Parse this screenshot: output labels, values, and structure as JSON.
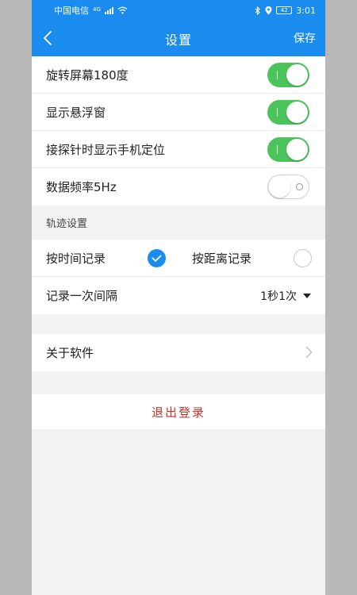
{
  "status_bar": {
    "carrier": "中国电信",
    "network": "4G",
    "battery": "42",
    "time": "3:01"
  },
  "header": {
    "title": "设置",
    "save_label": "保存"
  },
  "toggles": [
    {
      "label": "旋转屏幕180度",
      "on": true
    },
    {
      "label": "显示悬浮窗",
      "on": true
    },
    {
      "label": "接探针时显示手机定位",
      "on": true
    },
    {
      "label": "数据频率5Hz",
      "on": false
    }
  ],
  "track_settings": {
    "section_title": "轨迹设置",
    "options": [
      {
        "label": "按时间记录",
        "selected": true
      },
      {
        "label": "按距离记录",
        "selected": false
      }
    ],
    "interval_label": "记录一次间隔",
    "interval_value": "1秒1次"
  },
  "about": {
    "label": "关于软件"
  },
  "logout": {
    "label": "退出登录"
  },
  "colors": {
    "accent": "#1a8cf0",
    "toggle_on": "#4bc55b",
    "logout_text": "#c0342a",
    "background": "#f2f2f2"
  }
}
